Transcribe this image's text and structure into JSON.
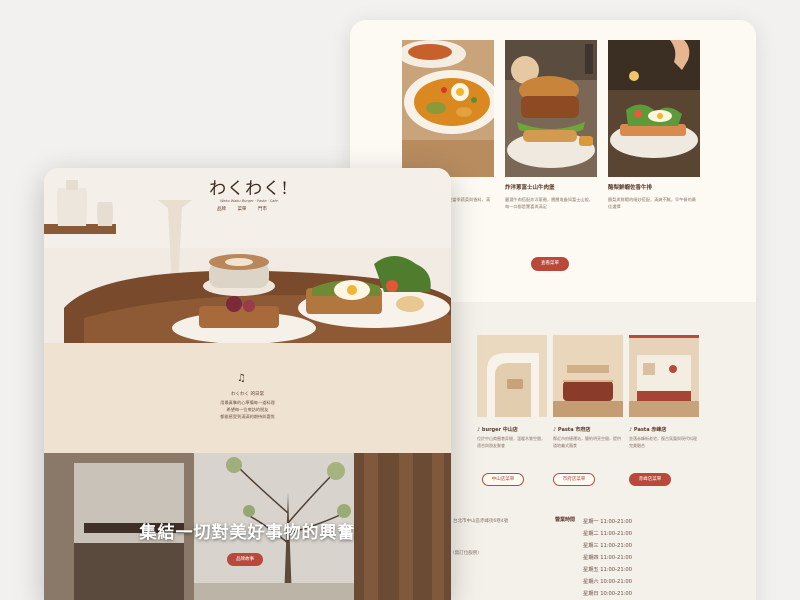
{
  "brand": {
    "logo_text": "わくわく!",
    "tagline": "Waku Waku Burger · Pasta · Cafe"
  },
  "nav": {
    "items": [
      "品牌",
      "菜單",
      "門市"
    ]
  },
  "menu_section": {
    "dishes": [
      {
        "name": "",
        "desc": "…份量十足的咖哩飯，搭配當季蔬菜與香料，滿足你的每一天"
      },
      {
        "name": "炸洋蔥富士山牛肉堡",
        "desc": "嚴選牛肉搭配炸洋蔥圈，層層堆疊如富士山般，每一口都是驚喜與滿足"
      },
      {
        "name": "酪梨鮮蝦佐香牛排",
        "desc": "酪梨與鮮蝦的絕妙搭配，清爽不膩，早午餐的最佳選擇"
      }
    ],
    "button_label": "查看菜單"
  },
  "stores_section": {
    "stores": [
      {
        "name": "",
        "desc": "…",
        "button_label": ""
      },
      {
        "name": "♪ burger 中山店",
        "desc": "位於中山商圈巷弄間，溫暖木質空間，適合與朋友聚會",
        "button_label": "中山店菜單"
      },
      {
        "name": "♪ Pasta 市府店",
        "desc": "鄰近市府捷運站，簡約明亮空間，提供道地義式麵食",
        "button_label": "市府店菜單"
      },
      {
        "name": "♪ Pasta 赤峰店",
        "desc": "坐落赤峰街老宅，復古氛圍與現代料理完美融合",
        "button_label": "赤峰店菜單"
      }
    ],
    "address_lines": [
      "台北市中山區赤峰街6巷4號",
      "(無訂位服務)"
    ],
    "hours_title": "營業時間",
    "hours": [
      "星期一 11:00-21:00",
      "星期二 11:00-21:00",
      "星期三 11:00-21:00",
      "星期四 11:00-21:00",
      "星期五 11:00-21:00",
      "星期六 10:00-21:00",
      "星期日 10:00-21:00"
    ]
  },
  "intro": {
    "title": "わくわく 的日常",
    "lines": [
      "用最真摯的心準備每一道料理",
      "希望每一位來訪的朋友",
      "都能感受到滿滿的期待與喜悅"
    ]
  },
  "banner": {
    "title": "集結一切對美好事物的興奮",
    "button_label": "品牌故事"
  },
  "colors": {
    "accent": "#b94a3b",
    "cream": "#fdfaf4",
    "beige": "#efe2d1",
    "brown": "#5a3a2a"
  }
}
